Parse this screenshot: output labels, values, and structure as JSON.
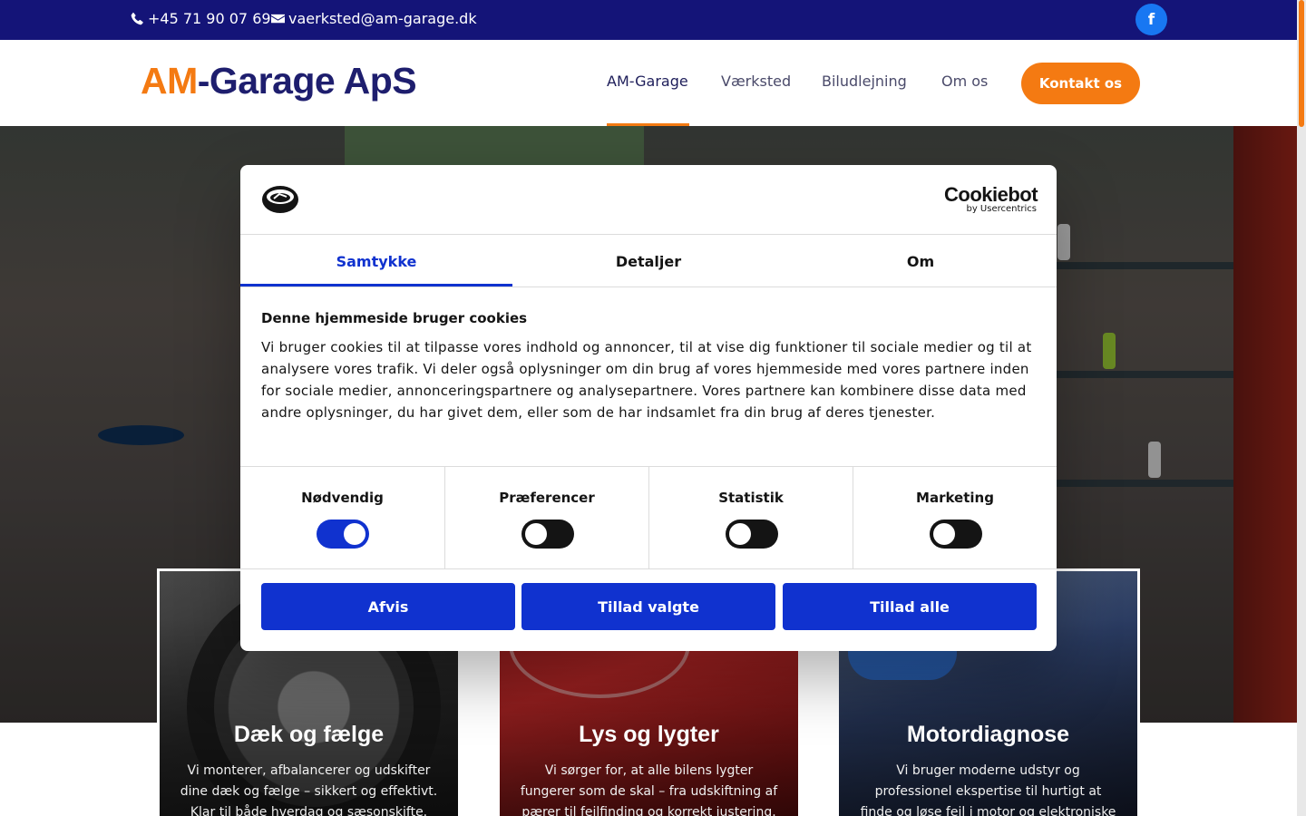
{
  "topbar": {
    "phone": "+45 71 90 07 69",
    "email": "vaerksted@am-garage.dk",
    "social_icon": "facebook-icon",
    "social_glyph": "f",
    "background_color": "#141478"
  },
  "header": {
    "logo_accent": "AM",
    "logo_rest": "-Garage ApS",
    "nav": [
      "AM-Garage",
      "Værksted",
      "Biludlejning",
      "Om os"
    ],
    "active_nav": "AM-Garage",
    "cta_label": "Kontakt os",
    "accent_color": "#f47a12",
    "brand_color": "#1e1e6e"
  },
  "cards": [
    {
      "title": "Dæk og fælge",
      "text": "Vi monterer, afbalancerer og udskifter dine dæk og fælge – sikkert og effektivt. Klar til både hverdag og sæsonskifte."
    },
    {
      "title": "Lys og lygter",
      "text": "Vi sørger for, at alle bilens lygter fungerer som de skal – fra udskiftning af pærer til fejlfinding og korrekt justering."
    },
    {
      "title": "Motordiagnose",
      "text": "Vi bruger moderne udstyr og professionel ekspertise til hurtigt at finde og løse fejl i motor og elektroniske"
    }
  ],
  "cookie": {
    "brand": "Cookiebot",
    "brand_sub": "by Usercentrics",
    "tabs": [
      "Samtykke",
      "Detaljer",
      "Om"
    ],
    "active_tab": "Samtykke",
    "title": "Denne hjemmeside bruger cookies",
    "text": "Vi bruger cookies til at tilpasse vores indhold og annoncer, til at vise dig funktioner til sociale medier og til at analysere vores trafik. Vi deler også oplysninger om din brug af vores hjemmeside med vores partnere inden for sociale medier, annonceringspartnere og analysepartnere. Vores partnere kan kombinere disse data med andre oplysninger, du har givet dem, eller som de har indsamlet fra din brug af deres tjenester.",
    "toggles": [
      {
        "label": "Nødvendig",
        "on": true
      },
      {
        "label": "Præferencer",
        "on": false
      },
      {
        "label": "Statistik",
        "on": false
      },
      {
        "label": "Marketing",
        "on": false
      }
    ],
    "buttons": {
      "reject": "Afvis",
      "allow_selected": "Tillad valgte",
      "allow_all": "Tillad alle"
    },
    "primary_color": "#1032cf"
  }
}
